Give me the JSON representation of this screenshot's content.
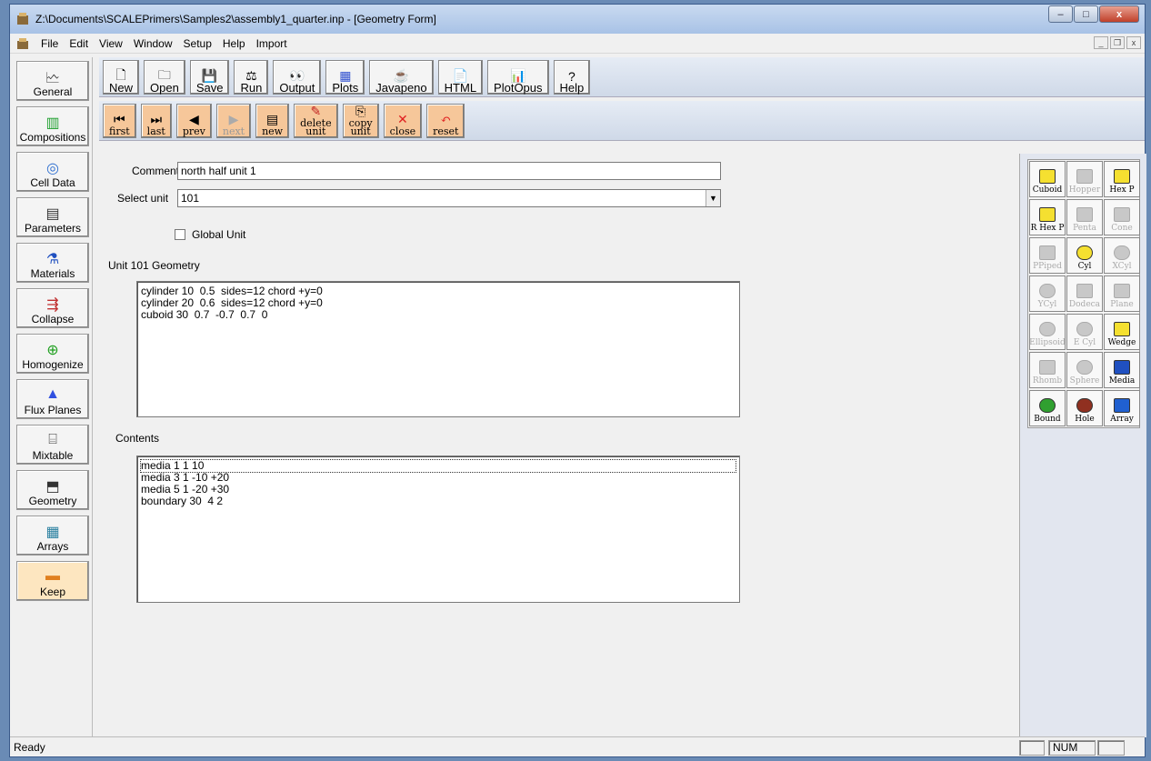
{
  "window": {
    "title": "Z:\\Documents\\SCALEPrimers\\Samples2\\assembly1_quarter.inp - [Geometry Form]",
    "minimize": "–",
    "maximize": "□",
    "close": "x"
  },
  "menu": {
    "items": [
      "File",
      "Edit",
      "View",
      "Window",
      "Setup",
      "Help",
      "Import"
    ]
  },
  "toolbar1": [
    {
      "label": "New",
      "icon": "new-file-icon"
    },
    {
      "label": "Open",
      "icon": "open-folder-icon"
    },
    {
      "label": "Save",
      "icon": "save-disk-icon"
    },
    {
      "label": "Run",
      "icon": "run-scale-icon"
    },
    {
      "label": "Output",
      "icon": "output-eyes-icon"
    },
    {
      "label": "Plots",
      "icon": "plots-grid-icon"
    },
    {
      "label": "Javapeno",
      "icon": "javapeno-icon"
    },
    {
      "label": "HTML",
      "icon": "html-icon"
    },
    {
      "label": "PlotOpus",
      "icon": "plotopus-icon"
    },
    {
      "label": "Help",
      "icon": "help-icon"
    }
  ],
  "toolbar2": [
    {
      "label": "first",
      "icon": "first-icon",
      "enabled": true
    },
    {
      "label": "last",
      "icon": "last-icon",
      "enabled": true
    },
    {
      "label": "prev",
      "icon": "prev-icon",
      "enabled": true
    },
    {
      "label": "next",
      "icon": "next-icon",
      "enabled": false
    },
    {
      "label": "new",
      "icon": "new-unit-icon",
      "enabled": true
    },
    {
      "label": "delete\nunit",
      "icon": "delete-unit-icon",
      "enabled": true
    },
    {
      "label": "copy\nunit",
      "icon": "copy-unit-icon",
      "enabled": true
    },
    {
      "label": "close",
      "icon": "close-x-icon",
      "enabled": true
    },
    {
      "label": "reset",
      "icon": "reset-icon",
      "enabled": true
    }
  ],
  "sidebar": [
    {
      "label": "General",
      "icon": "general-icon"
    },
    {
      "label": "Compositions",
      "icon": "compositions-icon"
    },
    {
      "label": "Cell Data",
      "icon": "cell-data-icon"
    },
    {
      "label": "Parameters",
      "icon": "parameters-icon"
    },
    {
      "label": "Materials",
      "icon": "materials-icon"
    },
    {
      "label": "Collapse",
      "icon": "collapse-icon"
    },
    {
      "label": "Homogenize",
      "icon": "homogenize-icon"
    },
    {
      "label": "Flux Planes",
      "icon": "flux-planes-icon"
    },
    {
      "label": "Mixtable",
      "icon": "mixtable-icon"
    },
    {
      "label": "Geometry",
      "icon": "geometry-icon"
    },
    {
      "label": "Arrays",
      "icon": "arrays-icon"
    },
    {
      "label": "Keep",
      "icon": "keep-icon"
    }
  ],
  "form": {
    "comment_label": "Comment",
    "comment_value": "north half unit 1",
    "select_unit_label": "Select unit",
    "select_unit_value": "101",
    "global_unit_label": "Global Unit",
    "global_unit_checked": false,
    "geometry_heading": "Unit 101 Geometry",
    "geometry_lines": [
      "cylinder 10  0.5  sides=12 chord +y=0",
      "cylinder 20  0.6  sides=12 chord +y=0",
      "cuboid 30  0.7  -0.7  0.7  0"
    ],
    "contents_heading": "Contents",
    "contents_lines": [
      "media 1 1 10",
      "media 3 1 -10 +20",
      "media 5 1 -20 +30",
      "boundary 30  4 2"
    ]
  },
  "palette": [
    {
      "label": "Cuboid",
      "enabled": true,
      "icon": "cuboid-icon"
    },
    {
      "label": "Hopper",
      "enabled": false,
      "icon": "hopper-icon"
    },
    {
      "label": "Hex P",
      "enabled": true,
      "icon": "hex-prism-icon"
    },
    {
      "label": "R Hex P",
      "enabled": true,
      "icon": "rhex-prism-icon"
    },
    {
      "label": "Penta",
      "enabled": false,
      "icon": "penta-icon"
    },
    {
      "label": "Cone",
      "enabled": false,
      "icon": "cone-icon"
    },
    {
      "label": "PPiped",
      "enabled": false,
      "icon": "ppiped-icon"
    },
    {
      "label": "Cyl",
      "enabled": true,
      "icon": "cylinder-icon"
    },
    {
      "label": "XCyl",
      "enabled": false,
      "icon": "xcyl-icon"
    },
    {
      "label": "YCyl",
      "enabled": false,
      "icon": "ycyl-icon"
    },
    {
      "label": "Dodeca",
      "enabled": false,
      "icon": "dodeca-icon"
    },
    {
      "label": "Plane",
      "enabled": false,
      "icon": "plane-icon"
    },
    {
      "label": "Ellipsoid",
      "enabled": false,
      "icon": "ellipsoid-icon"
    },
    {
      "label": "E Cyl",
      "enabled": false,
      "icon": "ecyl-icon"
    },
    {
      "label": "Wedge",
      "enabled": true,
      "icon": "wedge-icon"
    },
    {
      "label": "Rhomb",
      "enabled": false,
      "icon": "rhomb-icon"
    },
    {
      "label": "Sphere",
      "enabled": false,
      "icon": "sphere-icon"
    },
    {
      "label": "Media",
      "enabled": true,
      "icon": "media-icon"
    },
    {
      "label": "Bound",
      "enabled": true,
      "icon": "bound-icon"
    },
    {
      "label": "Hole",
      "enabled": true,
      "icon": "hole-icon"
    },
    {
      "label": "Array",
      "enabled": true,
      "icon": "array-icon"
    }
  ],
  "status": {
    "text": "Ready",
    "num": "NUM"
  }
}
